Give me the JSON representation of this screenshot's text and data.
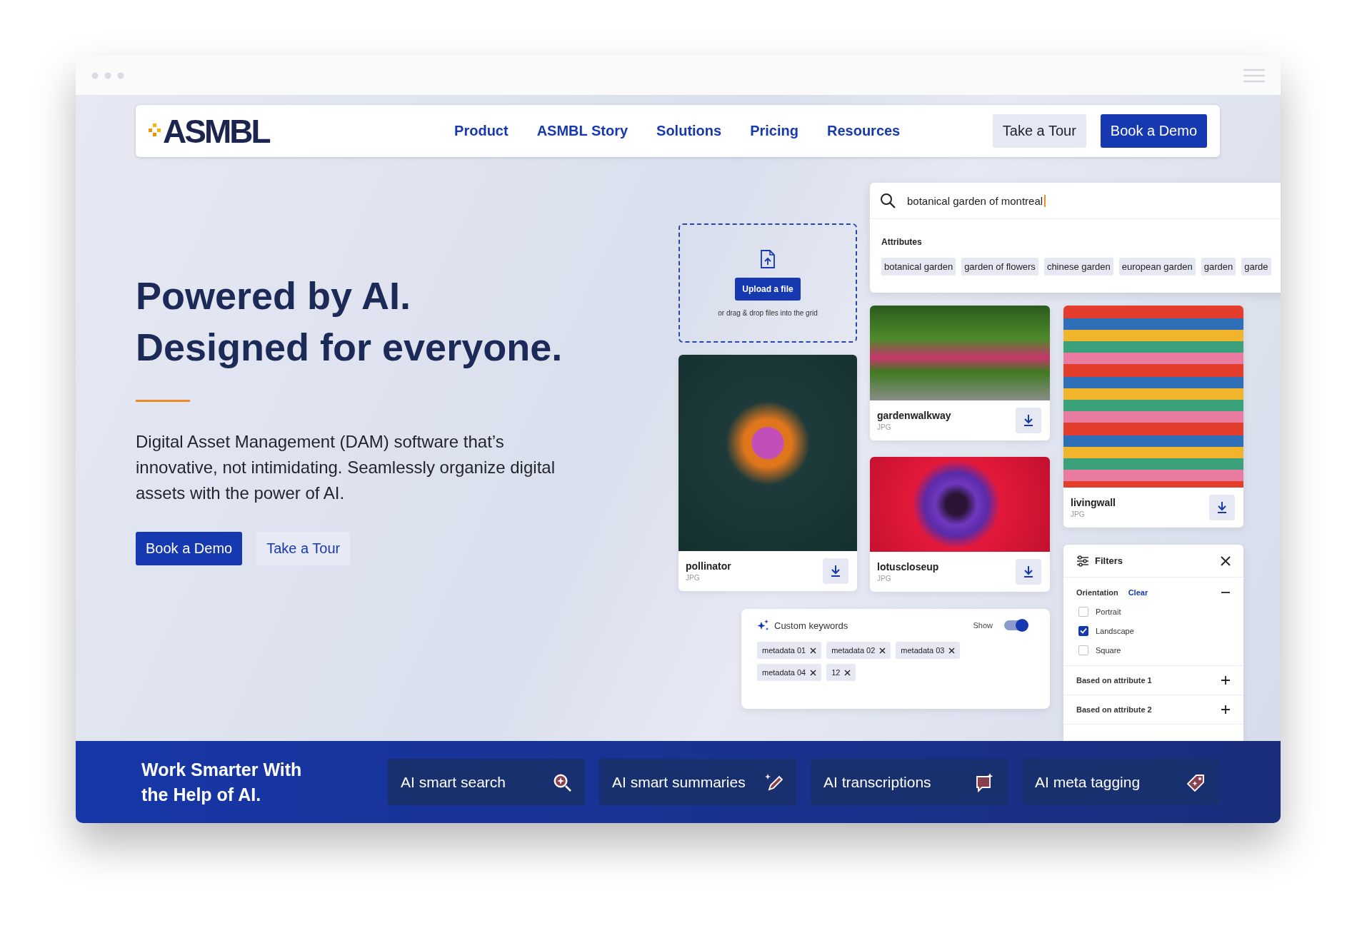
{
  "nav": {
    "logo": "ASMBL",
    "links": [
      "Product",
      "ASMBL Story",
      "Solutions",
      "Pricing",
      "Resources"
    ],
    "buttons": [
      {
        "label": "Take a Tour",
        "kind": "secondary"
      },
      {
        "label": "Book a Demo",
        "kind": "primary"
      }
    ]
  },
  "hero": {
    "title": [
      "Powered by AI.",
      "Designed for everyone."
    ],
    "description": "Digital Asset Management (DAM) software that’s innovative, not intimidating. Seamlessly organize digital assets with the power of AI.",
    "buttons": [
      {
        "label": "Book a Demo",
        "kind": "primary"
      },
      {
        "label": "Take a Tour",
        "kind": "secondary"
      }
    ]
  },
  "upload": {
    "button": "Upload a file",
    "hint": "or drag & drop files into the grid"
  },
  "search": {
    "value": "botanical garden of montreal",
    "attributes_label": "Attributes",
    "attributes": [
      "botanical garden",
      "garden of flowers",
      "chinese garden",
      "european garden",
      "garden",
      "garde"
    ]
  },
  "assets": [
    {
      "name": "pollinator",
      "type": "JPG"
    },
    {
      "name": "gardenwalkway",
      "type": "JPG"
    },
    {
      "name": "lotuscloseup",
      "type": "JPG"
    },
    {
      "name": "livingwall",
      "type": "JPG"
    }
  ],
  "keywords": {
    "title": "Custom keywords",
    "toggle_label": "Show",
    "on": true,
    "tags": [
      "metadata 01",
      "metadata 02",
      "metadata 03",
      "metadata 04",
      "12"
    ]
  },
  "filters": {
    "title": "Filters",
    "section": "Orientation",
    "clear": "Clear",
    "expanded": true,
    "options": [
      {
        "label": "Portrait",
        "checked": false
      },
      {
        "label": "Landscape",
        "checked": true
      },
      {
        "label": "Square",
        "checked": false
      }
    ],
    "groups": [
      {
        "label": "Based on attribute 1",
        "expanded": false
      },
      {
        "label": "Based on attribute 2",
        "expanded": false
      }
    ]
  },
  "banner": {
    "title": "Work Smarter With the Help of AI.",
    "features": [
      {
        "label": "AI smart search",
        "kind": "search"
      },
      {
        "label": "AI smart summaries",
        "kind": "summaries"
      },
      {
        "label": "AI transcriptions",
        "kind": "transcriptions"
      },
      {
        "label": "AI meta tagging",
        "kind": "tagging"
      }
    ]
  }
}
